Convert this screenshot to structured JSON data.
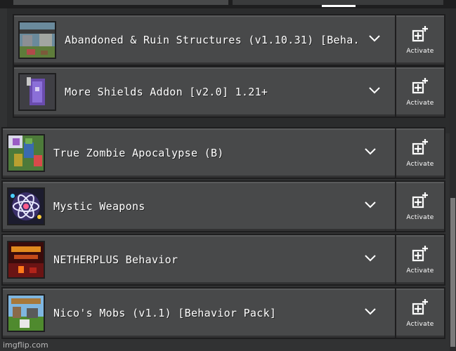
{
  "packs": [
    {
      "title": "Abandoned & Ruin Structures (v1.10.31) [Beha...",
      "activate_label": "Activate",
      "thumb": "abandoned-ruins-thumbnail"
    },
    {
      "title": "More Shields Addon [v2.0] 1.21+",
      "activate_label": "Activate",
      "thumb": "shield-thumbnail"
    },
    {
      "title": "True Zombie Apocalypse (B)",
      "activate_label": "Activate",
      "thumb": "zombie-thumbnail"
    },
    {
      "title": "Mystic Weapons",
      "activate_label": "Activate",
      "thumb": "mystic-atom-thumbnail"
    },
    {
      "title": "NETHERPLUS Behavior",
      "activate_label": "Activate",
      "thumb": "netherplus-thumbnail"
    },
    {
      "title": "Nico's Mobs (v1.1) [Behavior Pack]",
      "activate_label": "Activate",
      "thumb": "nicos-mobs-thumbnail"
    }
  ],
  "watermark": "imgflip.com",
  "colors": {
    "card": "#48494a",
    "border": "#1e1e1f",
    "background": "#313233"
  }
}
